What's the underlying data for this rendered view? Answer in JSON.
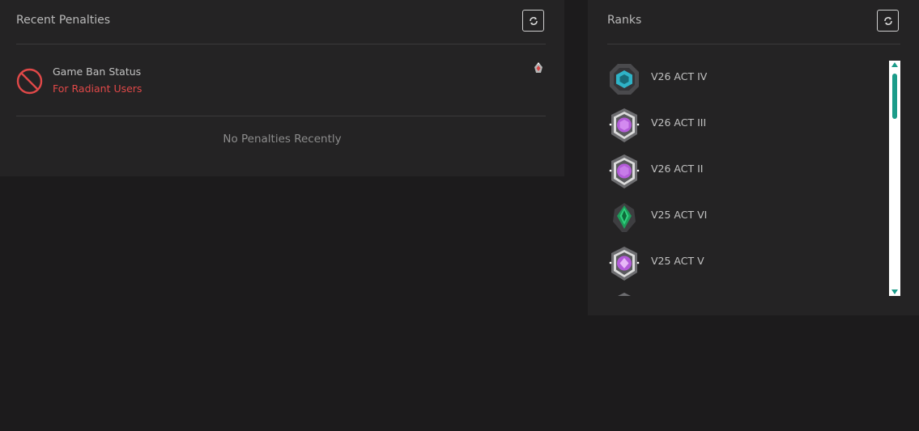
{
  "penalties": {
    "title": "Recent Penalties",
    "refresh_icon": "refresh-icon",
    "ban": {
      "icon": "ban-icon",
      "title": "Game Ban Status",
      "subtitle": "For Radiant Users",
      "subtitle_color": "#e04848",
      "badge_icon": "radiant-icon"
    },
    "empty_text": "No Penalties Recently"
  },
  "ranks": {
    "title": "Ranks",
    "refresh_icon": "refresh-icon",
    "items": [
      {
        "label": "V26 ACT IV",
        "icon": "rank-cyan-icon"
      },
      {
        "label": "V26 ACT III",
        "icon": "rank-purple-icon"
      },
      {
        "label": "V26 ACT II",
        "icon": "rank-purple-icon"
      },
      {
        "label": "V25 ACT VI",
        "icon": "rank-green-icon"
      },
      {
        "label": "V25 ACT V",
        "icon": "rank-purple-icon"
      }
    ],
    "scroll_accent": "#1c9c8a"
  }
}
